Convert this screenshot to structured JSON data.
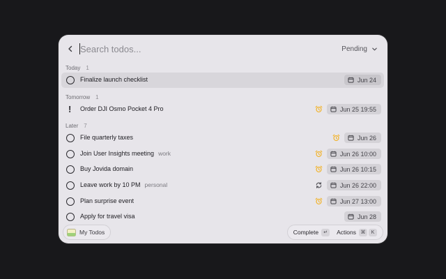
{
  "search": {
    "placeholder": "Search todos...",
    "value": ""
  },
  "filter": {
    "label": "Pending"
  },
  "sections": [
    {
      "label": "Today",
      "count": "1"
    },
    {
      "label": "Tomorrow",
      "count": "1"
    },
    {
      "label": "Later",
      "count": "7"
    }
  ],
  "todos": [
    {
      "title": "Finalize launch checklist",
      "tag": "",
      "date": "Jun 24",
      "alarm": false,
      "repeat": false,
      "priority": false
    },
    {
      "title": "Order DJI Osmo Pocket 4 Pro",
      "tag": "",
      "date": "Jun 25 19:55",
      "alarm": true,
      "repeat": false,
      "priority": true
    },
    {
      "title": "File quarterly taxes",
      "tag": "",
      "date": "Jun 26",
      "alarm": true,
      "repeat": false,
      "priority": false
    },
    {
      "title": "Join User Insights meeting",
      "tag": "work",
      "date": "Jun 26 10:00",
      "alarm": true,
      "repeat": false,
      "priority": false
    },
    {
      "title": "Buy Jovida domain",
      "tag": "",
      "date": "Jun 26 10:15",
      "alarm": true,
      "repeat": false,
      "priority": false
    },
    {
      "title": "Leave work by 10 PM",
      "tag": "personal",
      "date": "Jun 26 22:00",
      "alarm": false,
      "repeat": true,
      "priority": false
    },
    {
      "title": "Plan surprise event",
      "tag": "",
      "date": "Jun 27 13:00",
      "alarm": true,
      "repeat": false,
      "priority": false
    },
    {
      "title": "Apply for travel visa",
      "tag": "",
      "date": "Jun 28",
      "alarm": false,
      "repeat": false,
      "priority": false
    }
  ],
  "footer": {
    "list_name": "My Todos",
    "complete_label": "Complete",
    "complete_key": "↵",
    "actions_label": "Actions",
    "actions_keys": [
      "⌘",
      "K"
    ]
  },
  "colors": {
    "alarm": "#f2b227",
    "accent_bg": "#d8d6db"
  }
}
